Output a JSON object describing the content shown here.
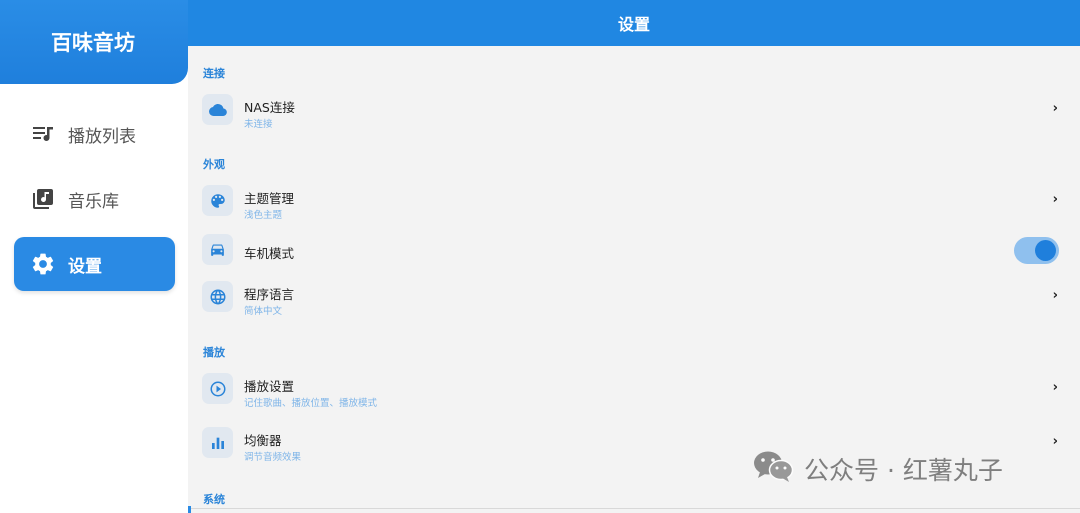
{
  "app": {
    "name": "百味音坊"
  },
  "sidebar": {
    "items": [
      {
        "label": "播放列表",
        "icon": "playlist-icon",
        "active": false
      },
      {
        "label": "音乐库",
        "icon": "music-library-icon",
        "active": false
      },
      {
        "label": "设置",
        "icon": "gear-icon",
        "active": true
      }
    ]
  },
  "header": {
    "title": "设置"
  },
  "sections": {
    "connection": {
      "title": "连接",
      "nas": {
        "title": "NAS连接",
        "subtitle": "未连接",
        "icon": "cloud-icon"
      }
    },
    "appearance": {
      "title": "外观",
      "theme": {
        "title": "主题管理",
        "subtitle": "浅色主题",
        "icon": "palette-icon"
      },
      "car_mode": {
        "title": "车机模式",
        "icon": "car-icon",
        "enabled": true
      },
      "language": {
        "title": "程序语言",
        "subtitle": "简体中文",
        "icon": "globe-icon"
      }
    },
    "playback": {
      "title": "播放",
      "play_settings": {
        "title": "播放设置",
        "subtitle": "记住歌曲、播放位置、播放模式",
        "icon": "play-circle-icon"
      },
      "equalizer": {
        "title": "均衡器",
        "subtitle": "调节音频效果",
        "icon": "equalizer-icon"
      }
    },
    "system": {
      "title": "系统"
    }
  },
  "watermark": {
    "text": "公众号 · 红薯丸子",
    "icon": "wechat-icon"
  },
  "colors": {
    "accent": "#2087e2",
    "background": "#f3f3f3",
    "subtitle": "#7fb5e8",
    "icon_bg": "#e1e8f0"
  }
}
